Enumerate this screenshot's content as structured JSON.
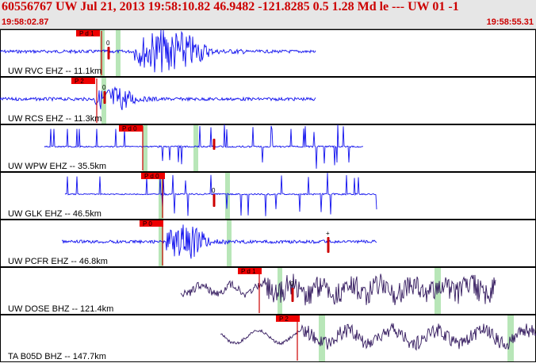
{
  "header": {
    "title": "60556767 UW Jul 21, 2013 19:58:10.82   46.9482 -121.8285  0.5 1.28 Md le --- UW 01  -1",
    "start_time": "19:58:02.87",
    "end_time": "19:58:55.31"
  },
  "colors": {
    "header_text": "#cc0000",
    "trace_blue": "#1010ee",
    "trace_purple": "#33195e",
    "pick_red": "#cc0000",
    "window_green": "#b8e6b8"
  },
  "panels": [
    {
      "label": "UW RVC EHZ -- 11.1km",
      "pick": "P d 1",
      "coda_mark": "0",
      "color": "#1010ee",
      "style": "burst"
    },
    {
      "label": "UW RCS EHZ -- 11.3km",
      "pick": "P 2",
      "coda_mark": "0",
      "color": "#1010ee",
      "style": "burst_small"
    },
    {
      "label": "UW WPW EHZ -- 35.5km",
      "pick": "P d 0",
      "coda_mark": "",
      "color": "#1010ee",
      "style": "spiky"
    },
    {
      "label": "UW GLK EHZ -- 46.5km",
      "pick": "P d 0",
      "coda_mark": "0",
      "color": "#1010ee",
      "style": "spiky2"
    },
    {
      "label": "UW PCFR EHZ -- 46.8km",
      "pick": "P 0",
      "coda_mark": "+",
      "color": "#1010ee",
      "style": "burst_late"
    },
    {
      "label": "UW DOSE BHZ -- 121.4km",
      "pick": "P d 1",
      "coda_mark": "0",
      "color": "#33195e",
      "style": "noisy"
    },
    {
      "label": "TA B05D BHZ -- 147.7km",
      "pick": "P 2",
      "coda_mark": "",
      "color": "#33195e",
      "style": "wavy"
    }
  ]
}
